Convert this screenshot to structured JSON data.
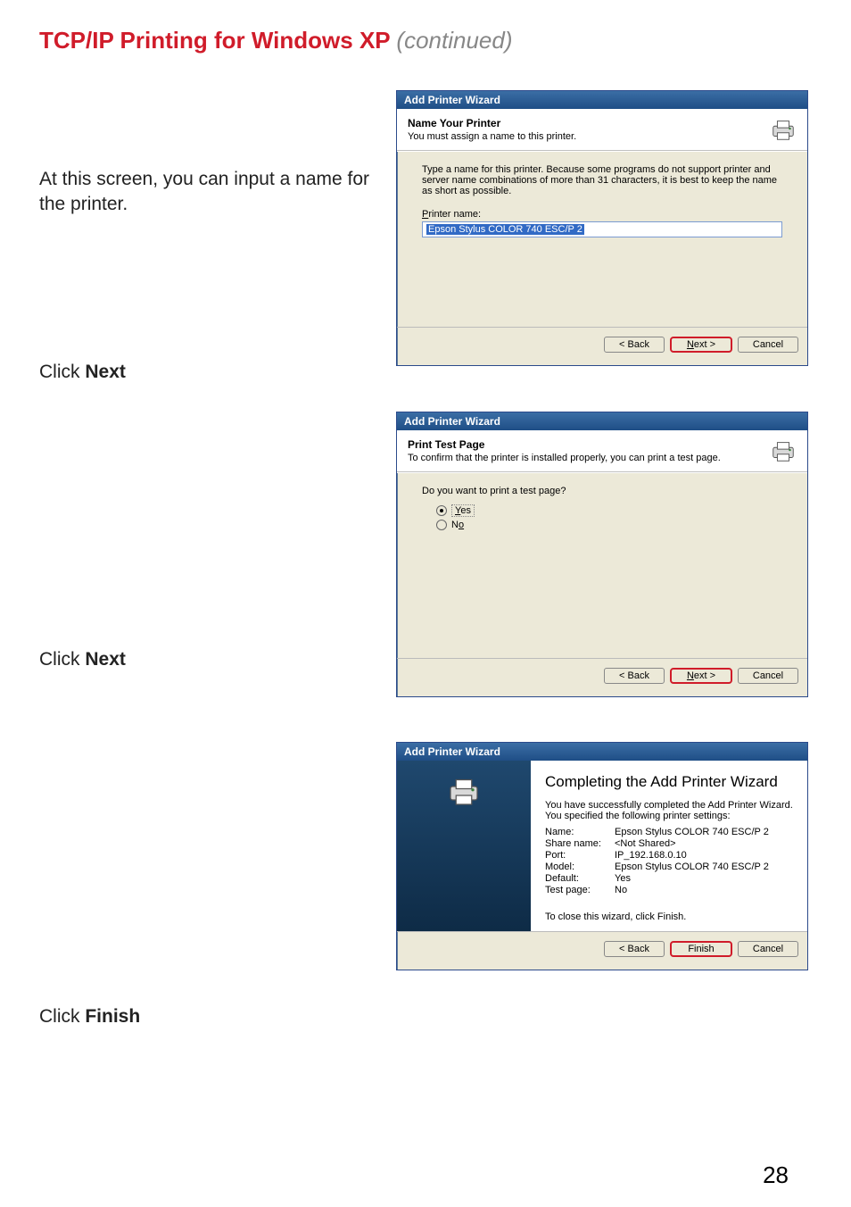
{
  "page": {
    "title_red": "TCP/IP Printing for Windows XP",
    "title_cont": "(continued)",
    "number": "28"
  },
  "instructions": {
    "intro": "At this screen, you can input a name for the printer.",
    "click": "Click",
    "next": "Next",
    "finish": "Finish"
  },
  "wizard_common": {
    "title": "Add Printer Wizard",
    "back": "< Back",
    "next": "Next >",
    "cancel": "Cancel",
    "finish": "Finish"
  },
  "wizard1": {
    "heading": "Name Your Printer",
    "sub": "You must assign a name to this printer.",
    "body": "Type a name for this printer. Because some programs do not support printer and server name combinations of more than 31 characters, it is best to keep the name as short as possible.",
    "label": "Printer name:",
    "value": "Epson Stylus COLOR 740 ESC/P 2"
  },
  "wizard2": {
    "heading": "Print Test Page",
    "sub": "To confirm that the printer is installed properly, you can print a test page.",
    "question": "Do you want to print a test page?",
    "yes": "Yes",
    "no": "No"
  },
  "wizard3": {
    "heading": "Completing the Add Printer Wizard",
    "line1": "You have successfully completed the Add Printer Wizard.",
    "line2": "You specified the following printer settings:",
    "labels": {
      "name": "Name:",
      "share": "Share name:",
      "port": "Port:",
      "model": "Model:",
      "default": "Default:",
      "test": "Test page:"
    },
    "values": {
      "name": "Epson Stylus COLOR 740 ESC/P 2",
      "share": "<Not Shared>",
      "port": "IP_192.168.0.10",
      "model": "Epson Stylus COLOR 740 ESC/P 2",
      "default": "Yes",
      "test": "No"
    },
    "close": "To close this wizard, click Finish."
  }
}
